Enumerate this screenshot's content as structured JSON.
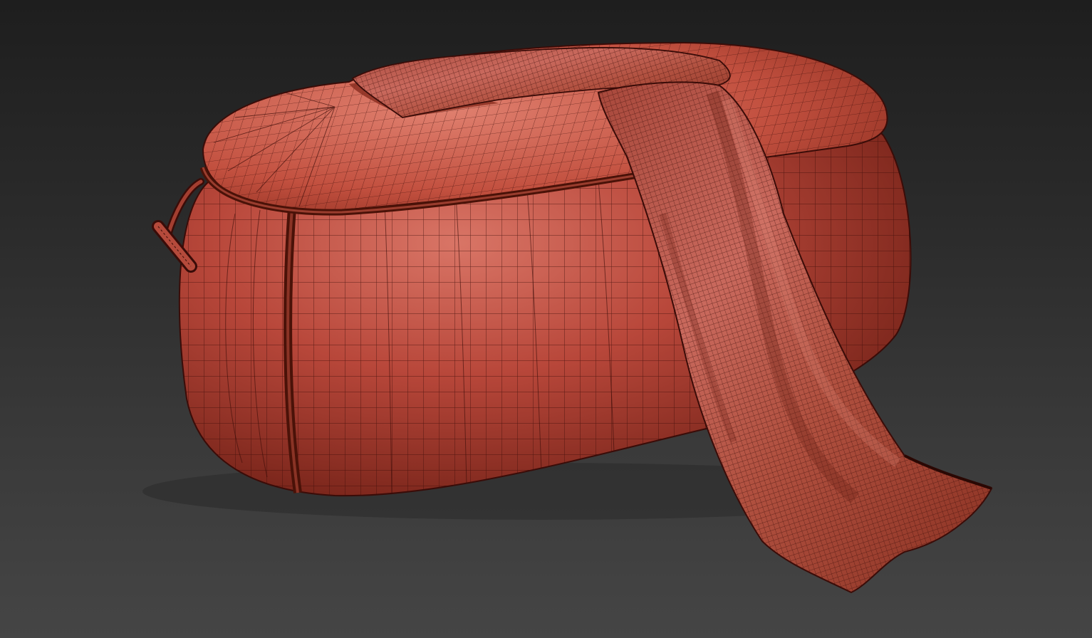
{
  "viewport": {
    "mode": "wireframe-over-shaded",
    "background_colors": [
      "#1e1e1e",
      "#454545"
    ]
  },
  "model": {
    "object": "pouf-with-draped-blanket",
    "colors": {
      "pouf_light": "#d46a5c",
      "pouf_mid": "#b8483a",
      "pouf_dark": "#7a2418",
      "wire": "#3a0c08",
      "blanket_light": "#c86a60",
      "blanket_dark": "#8c3528"
    },
    "parts": [
      "pouf-body",
      "pouf-top-cushion",
      "seam-piping",
      "side-handle",
      "draped-blanket"
    ]
  }
}
